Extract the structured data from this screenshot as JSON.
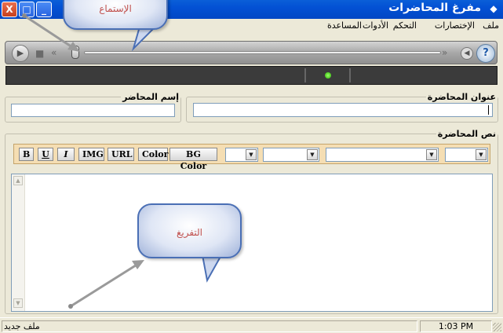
{
  "window": {
    "title": "مفرغ المحاضرات",
    "min_label": "_",
    "max_label": "□",
    "close_label": "X"
  },
  "menu": {
    "items": [
      "ملف",
      "الإختصارات",
      "التحكم",
      "الأدوات",
      "المساعدة"
    ]
  },
  "lecture_title": {
    "label": "عنوان المحاضرة",
    "value": ""
  },
  "lecturer_name": {
    "label": "إسم المحاضر",
    "value": ""
  },
  "lecture_text": {
    "label": "نص المحاضرة"
  },
  "toolbar": {
    "buttons": [
      "B",
      "U",
      "I",
      "IMG",
      "URL",
      "Color",
      "BG Color"
    ]
  },
  "callouts": {
    "listen": "الإستماع",
    "transcribe": "التفريغ"
  },
  "statusbar": {
    "left": "ملف جديد",
    "time": "1:03 PM"
  },
  "colors": {
    "titlebar": "#0351d4",
    "toolbar_bg": "#f5deb3",
    "callout_text": "#c0504d",
    "led": "#27b300"
  }
}
